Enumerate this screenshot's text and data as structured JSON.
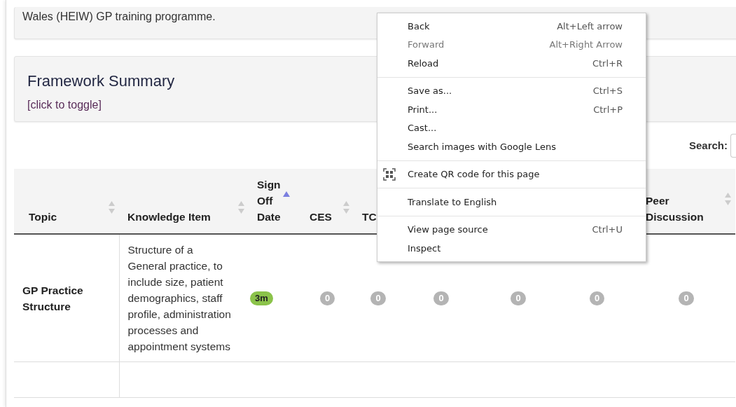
{
  "intro": {
    "text": "Wales (HEIW) GP training programme."
  },
  "summary": {
    "title": "Framework Summary",
    "toggle_link": "[click to toggle]"
  },
  "search": {
    "label": "Search:"
  },
  "table": {
    "columns": [
      {
        "label": "Topic",
        "sorted": false
      },
      {
        "label": "Knowledge Item",
        "sorted": false
      },
      {
        "label": "Sign Off Date",
        "sorted": true
      },
      {
        "label": "CES",
        "sorted": false
      },
      {
        "label": "TC"
      },
      {},
      {},
      {},
      {
        "label": "Peer Discussion",
        "sorted": false
      }
    ],
    "rows": [
      {
        "topic": "GP Practice Structure",
        "knowledge_item": "Structure of a General practice, to include size, patient demographics, staff profile, administration processes and appointment systems",
        "badges": [
          {
            "text": "3m",
            "kind": "done"
          },
          {
            "text": "0",
            "kind": "zero"
          },
          {
            "text": "0",
            "kind": "zero"
          },
          {
            "text": "0",
            "kind": "zero"
          },
          {
            "text": "0",
            "kind": "zero"
          },
          {
            "text": "0",
            "kind": "zero"
          },
          {
            "text": "0",
            "kind": "zero"
          }
        ]
      }
    ]
  },
  "context_menu": {
    "sections": [
      [
        {
          "label": "Back",
          "shortcut": "Alt+Left arrow",
          "disabled": false
        },
        {
          "label": "Forward",
          "shortcut": "Alt+Right Arrow",
          "disabled": true
        },
        {
          "label": "Reload",
          "shortcut": "Ctrl+R",
          "disabled": false
        }
      ],
      [
        {
          "label": "Save as...",
          "shortcut": "Ctrl+S",
          "disabled": false
        },
        {
          "label": "Print...",
          "shortcut": "Ctrl+P",
          "disabled": false
        },
        {
          "label": "Cast...",
          "disabled": false
        },
        {
          "label": "Search images with Google Lens",
          "disabled": false
        }
      ],
      [
        {
          "label": "Create QR code for this page",
          "kind": "qr",
          "disabled": false
        }
      ],
      [
        {
          "label": "Translate to English",
          "disabled": false
        }
      ],
      [
        {
          "label": "View page source",
          "shortcut": "Ctrl+U",
          "disabled": false
        },
        {
          "label": "Inspect",
          "disabled": false
        }
      ]
    ]
  }
}
